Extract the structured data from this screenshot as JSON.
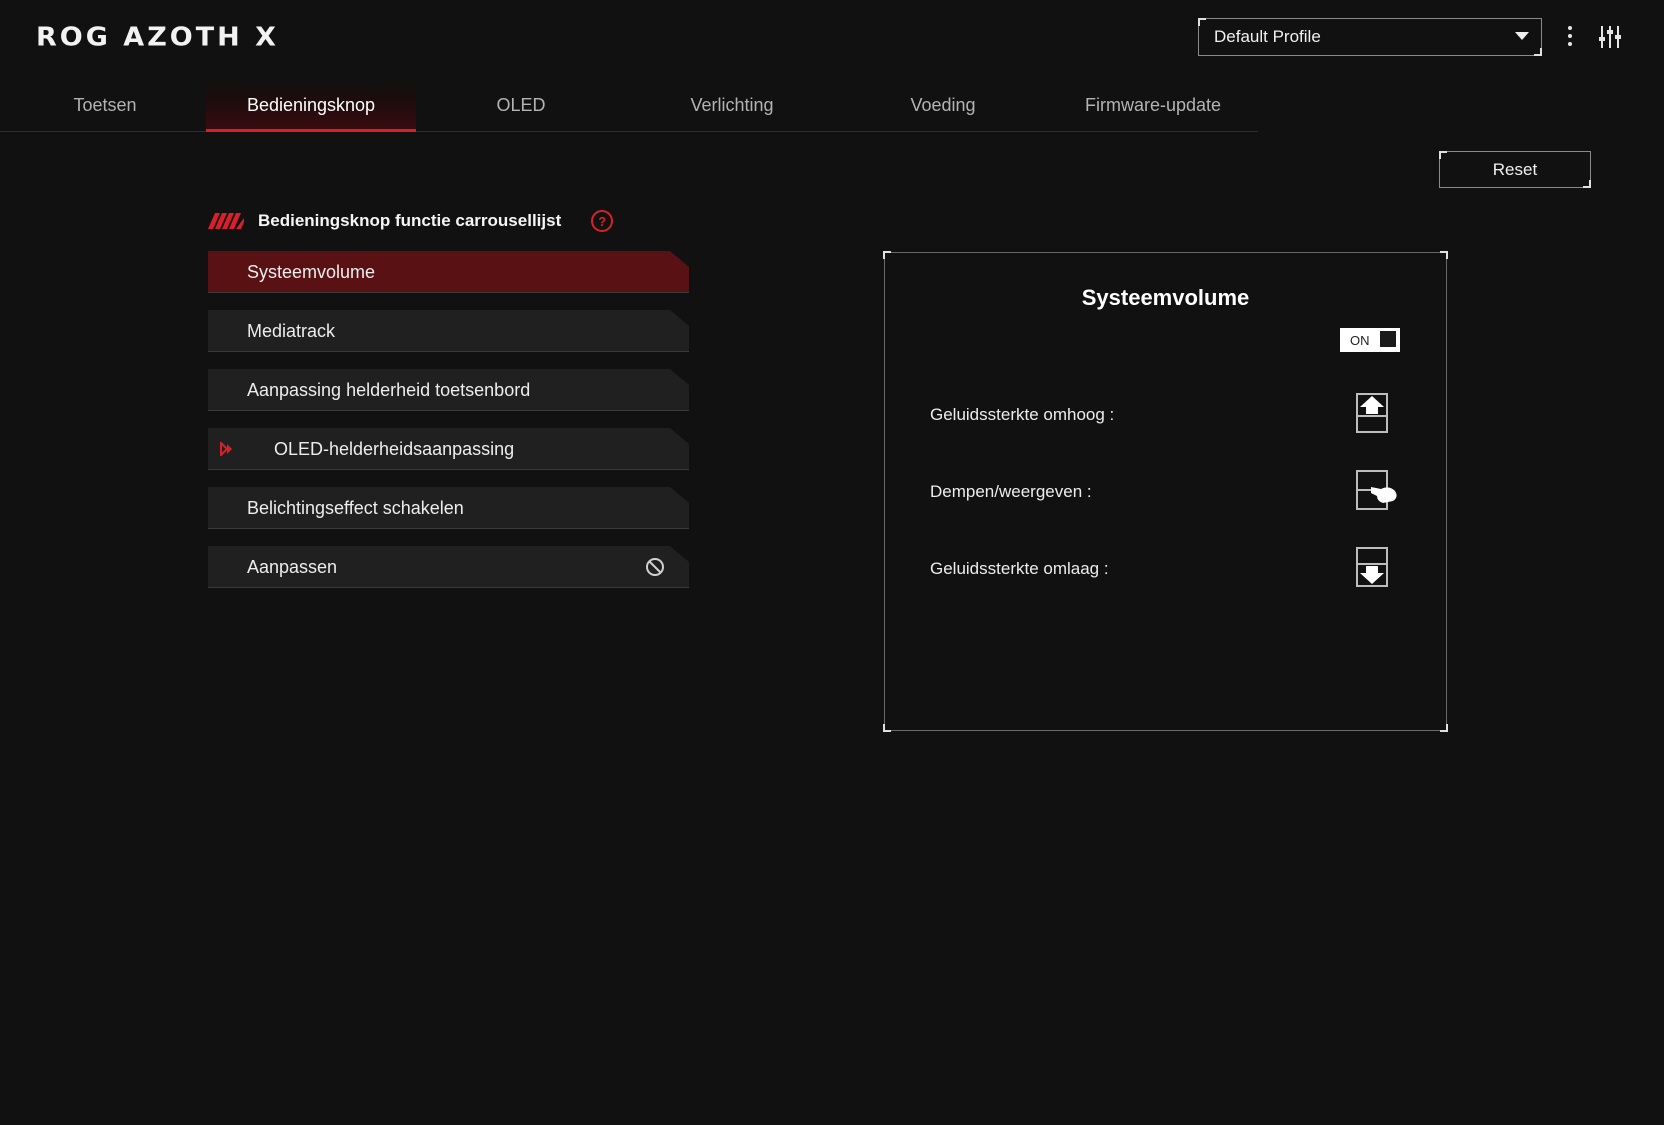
{
  "app": {
    "title": "ROG AZOTH X"
  },
  "profile": {
    "selected": "Default Profile"
  },
  "tabs": [
    {
      "label": "Toetsen"
    },
    {
      "label": "Bedieningsknop"
    },
    {
      "label": "OLED"
    },
    {
      "label": "Verlichting"
    },
    {
      "label": "Voeding"
    },
    {
      "label": "Firmware-update"
    }
  ],
  "active_tab": "Bedieningsknop",
  "reset_label": "Reset",
  "section": {
    "title": "Bedieningsknop functie carrousellijst",
    "help_glyph": "?"
  },
  "carousel": [
    {
      "label": "Systeemvolume",
      "active": true
    },
    {
      "label": "Mediatrack"
    },
    {
      "label": "Aanpassing helderheid toetsenbord"
    },
    {
      "label": "OLED-helderheidsaanpassing",
      "indicator": "red-arrow-icon"
    },
    {
      "label": "Belichtingseffect schakelen"
    },
    {
      "label": "Aanpassen",
      "icon": "disabled-icon"
    }
  ],
  "detail": {
    "title": "Systeemvolume",
    "toggle_label": "ON",
    "rows": [
      {
        "label": "Geluidssterkte omhoog :",
        "icon": "volume-up-icon"
      },
      {
        "label": "Dempen/weergeven :",
        "icon": "knob-press-icon"
      },
      {
        "label": "Geluidssterkte omlaag :",
        "icon": "volume-down-icon"
      }
    ]
  },
  "colors": {
    "accent": "#d8202b",
    "active_item": "#5a1114",
    "background": "#111111"
  }
}
